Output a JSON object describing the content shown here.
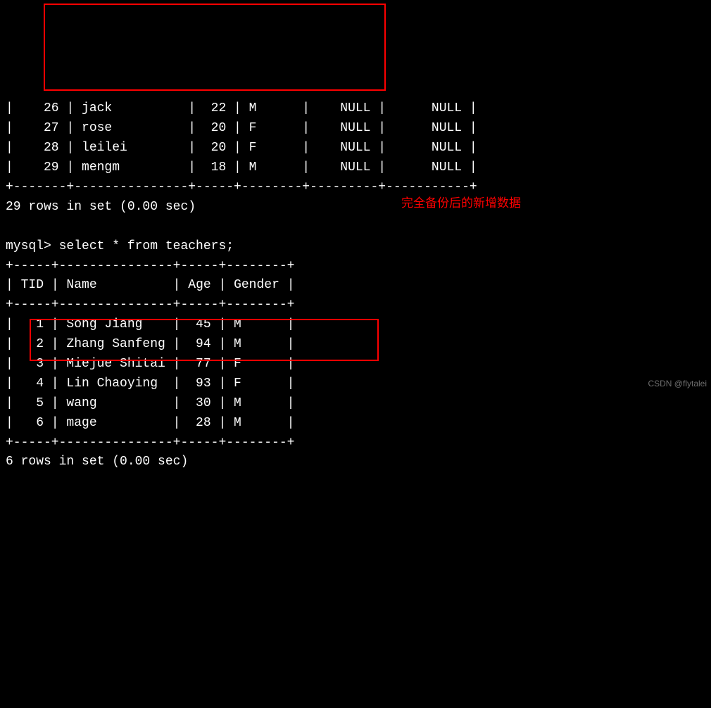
{
  "students_rows": [
    {
      "id": "26",
      "name": "jack",
      "age": "22",
      "gender": "M",
      "c1": "NULL",
      "c2": "NULL"
    },
    {
      "id": "27",
      "name": "rose",
      "age": "20",
      "gender": "F",
      "c1": "NULL",
      "c2": "NULL"
    },
    {
      "id": "28",
      "name": "leilei",
      "age": "20",
      "gender": "F",
      "c1": "NULL",
      "c2": "NULL"
    },
    {
      "id": "29",
      "name": "mengm",
      "age": "18",
      "gender": "M",
      "c1": "NULL",
      "c2": "NULL"
    }
  ],
  "students_footer": "29 rows in set (0.00 sec)",
  "prompt": "mysql>",
  "query2": " select * from teachers;",
  "teachers_header": {
    "tid": "TID",
    "name": "Name",
    "age": "Age",
    "gender": "Gender"
  },
  "teachers_rows": [
    {
      "tid": "1",
      "name": "Song Jiang",
      "age": "45",
      "gender": "M"
    },
    {
      "tid": "2",
      "name": "Zhang Sanfeng",
      "age": "94",
      "gender": "M"
    },
    {
      "tid": "3",
      "name": "Miejue Shitai",
      "age": "77",
      "gender": "F"
    },
    {
      "tid": "4",
      "name": "Lin Chaoying",
      "age": "93",
      "gender": "F"
    },
    {
      "tid": "5",
      "name": "wang",
      "age": "30",
      "gender": "M"
    },
    {
      "tid": "6",
      "name": "mage",
      "age": "28",
      "gender": "M"
    }
  ],
  "teachers_footer": "6 rows in set (0.00 sec)",
  "annotation": "完全备份后的新增数据",
  "watermark": "CSDN @flytalei",
  "top_divider": "+-------+---------------+-----+--------+---------+-----------+",
  "teachers_divider": "+-----+---------------+-----+--------+"
}
